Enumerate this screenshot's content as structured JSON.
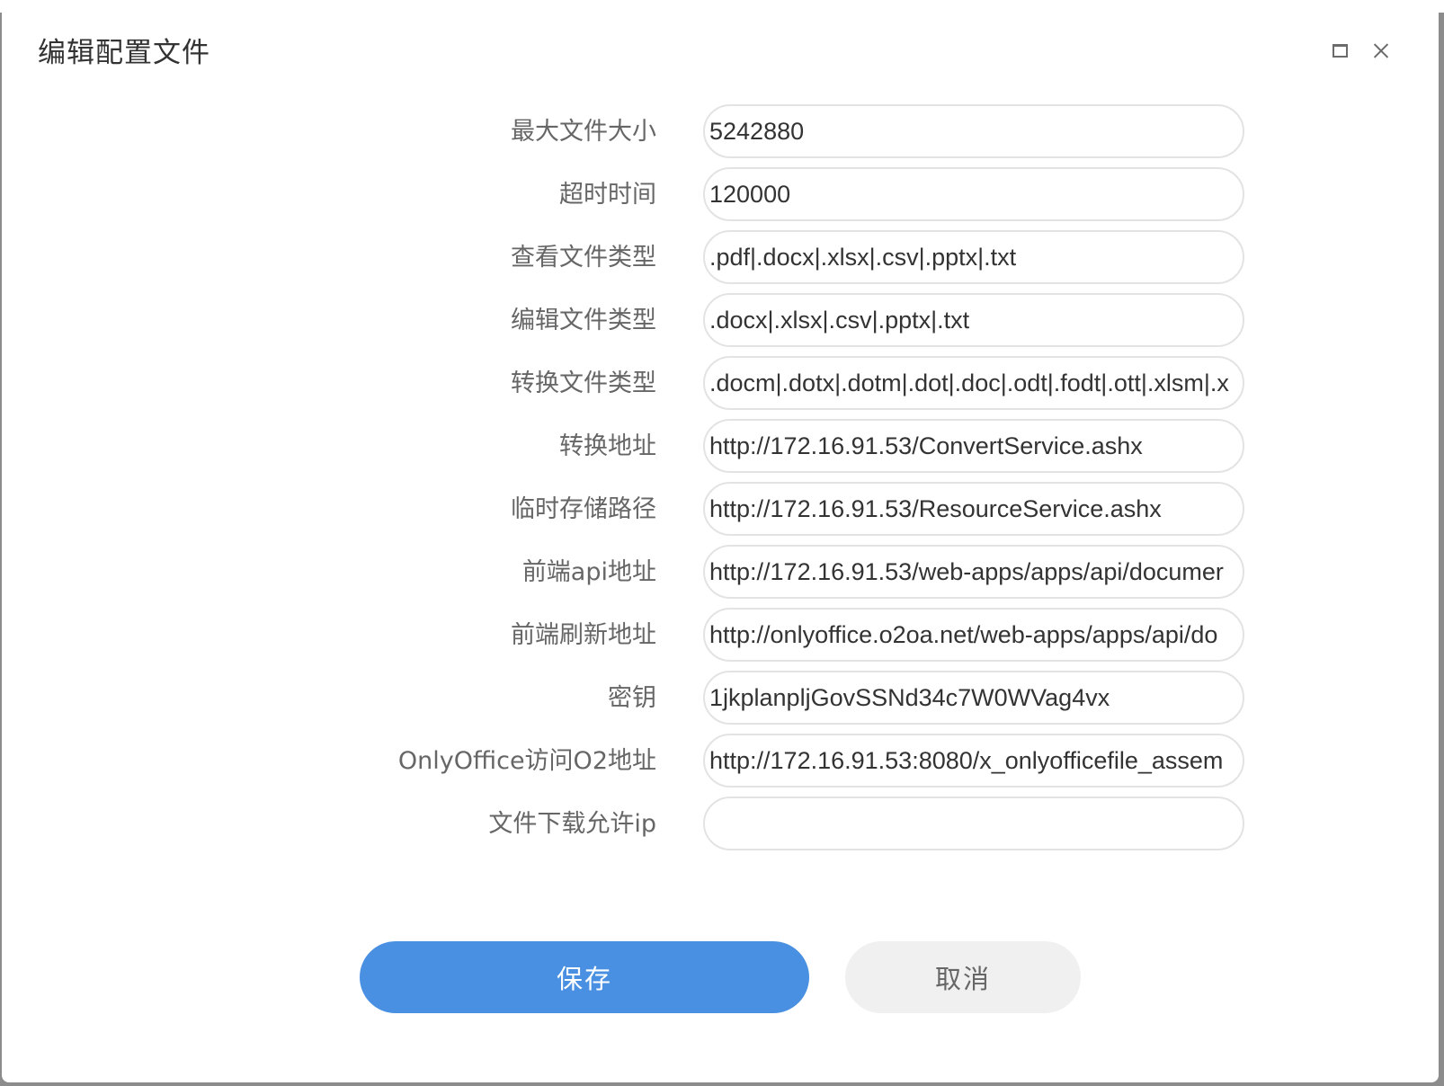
{
  "dialog": {
    "title": "编辑配置文件",
    "maximize_icon": "maximize-icon",
    "close_icon": "close-icon"
  },
  "fields": [
    {
      "label": "最大文件大小",
      "value": "5242880"
    },
    {
      "label": "超时时间",
      "value": "120000"
    },
    {
      "label": "查看文件类型",
      "value": ".pdf|.docx|.xlsx|.csv|.pptx|.txt"
    },
    {
      "label": "编辑文件类型",
      "value": ".docx|.xlsx|.csv|.pptx|.txt"
    },
    {
      "label": "转换文件类型",
      "value": ".docm|.dotx|.dotm|.dot|.doc|.odt|.fodt|.ott|.xlsm|.x"
    },
    {
      "label": "转换地址",
      "value": "http://172.16.91.53/ConvertService.ashx"
    },
    {
      "label": "临时存储路径",
      "value": "http://172.16.91.53/ResourceService.ashx"
    },
    {
      "label": "前端api地址",
      "value": "http://172.16.91.53/web-apps/apps/api/documer"
    },
    {
      "label": "前端刷新地址",
      "value": "http://onlyoffice.o2oa.net/web-apps/apps/api/do"
    },
    {
      "label": "密钥",
      "value": "1jkplanpljGovSSNd34c7W0WVag4vx"
    },
    {
      "label": "OnlyOffice访问O2地址",
      "value": "http://172.16.91.53:8080/x_onlyofficefile_assem"
    },
    {
      "label": "文件下载允许ip",
      "value": ""
    }
  ],
  "buttons": {
    "save_label": "保存",
    "cancel_label": "取消"
  },
  "colors": {
    "primary": "#4a90e2",
    "secondary": "#f0f0f0"
  }
}
